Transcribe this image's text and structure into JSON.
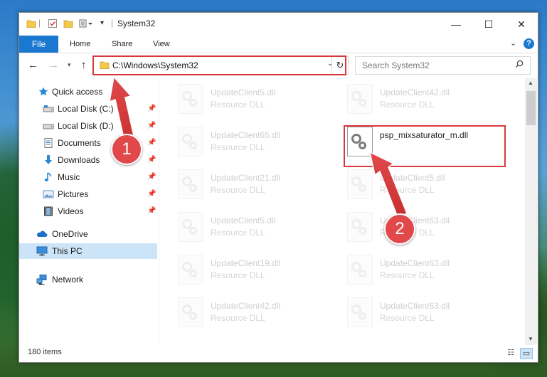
{
  "window": {
    "title": "System32",
    "controls": [
      "—",
      "☐",
      "✕"
    ]
  },
  "ribbon": {
    "tabs": [
      "File",
      "Home",
      "Share",
      "View"
    ],
    "help": "?"
  },
  "nav": {
    "address": "C:\\Windows\\System32",
    "search_placeholder": "Search System32"
  },
  "sidebar": {
    "items": [
      {
        "label": "Quick access",
        "icon": "star-icon"
      },
      {
        "label": "Local Disk (C:)",
        "icon": "drive-icon"
      },
      {
        "label": "Local Disk (D:)",
        "icon": "drive-icon"
      },
      {
        "label": "Documents",
        "icon": "documents-icon"
      },
      {
        "label": "Downloads",
        "icon": "download-arrow-icon"
      },
      {
        "label": "Music",
        "icon": "music-note-icon"
      },
      {
        "label": "Pictures",
        "icon": "pictures-icon"
      },
      {
        "label": "Videos",
        "icon": "film-icon"
      },
      {
        "label": "OneDrive",
        "icon": "cloud-icon"
      },
      {
        "label": "This PC",
        "icon": "monitor-icon"
      },
      {
        "label": "Network",
        "icon": "network-icon"
      }
    ]
  },
  "files": {
    "left": [
      {
        "name": "UpdateClient5.dll",
        "type": "Resource DLL"
      },
      {
        "name": "UpdateClient65.dll",
        "type": "Resource DLL"
      },
      {
        "name": "UpdateClient21.dll",
        "type": "Resource DLL"
      },
      {
        "name": "UpdateClient5.dll",
        "type": "Resource DLL"
      },
      {
        "name": "UpdateClient19.dll",
        "type": "Resource DLL"
      },
      {
        "name": "UpdateClient42.dll",
        "type": "Resource DLL"
      }
    ],
    "right": [
      {
        "name": "UpdateClient42.dll",
        "type": "Resource DLL"
      },
      {
        "name": "psp_mixsaturator_m.dll",
        "type": ""
      },
      {
        "name": "UpdateClient5.dll",
        "type": "Resource DLL"
      },
      {
        "name": "UpdateClient63.dll",
        "type": "Resource DLL"
      },
      {
        "name": "UpdateClient63.dll",
        "type": "Resource DLL"
      },
      {
        "name": "UpdateClient63.dll",
        "type": "Resource DLL"
      }
    ]
  },
  "status": {
    "item_count": "180 items"
  },
  "annotations": {
    "step1": "1",
    "step2": "2",
    "color": "#d9393b"
  }
}
